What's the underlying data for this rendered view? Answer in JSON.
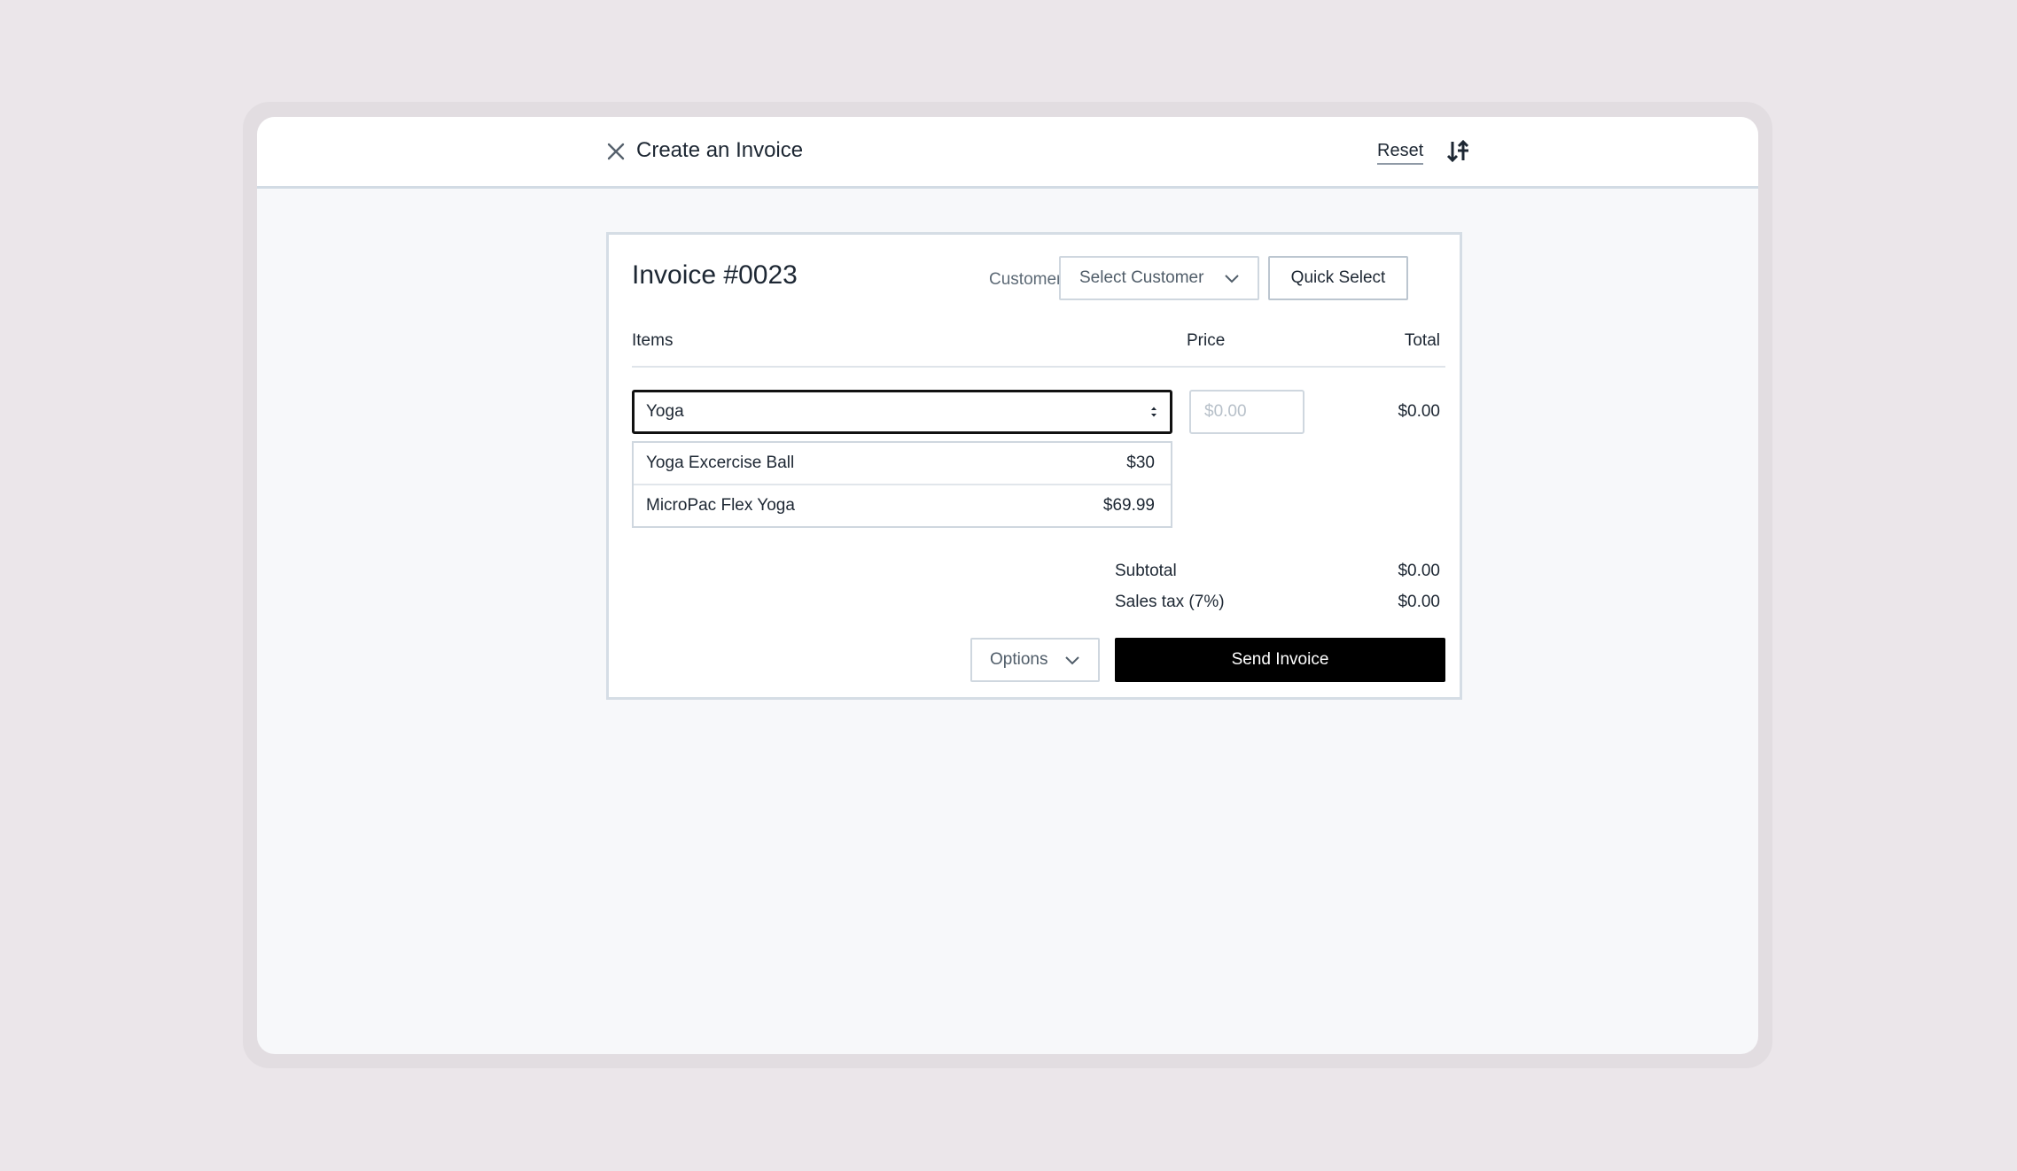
{
  "header": {
    "title": "Create an Invoice",
    "reset_label": "Reset",
    "close_icon": "close-icon",
    "sort_icon": "sort-icon"
  },
  "invoice": {
    "title": "Invoice #0023",
    "customer_label": "Customer:",
    "select_customer_label": "Select Customer",
    "quick_select_label": "Quick Select"
  },
  "table": {
    "columns": [
      "Items",
      "Price",
      "Total"
    ],
    "row": {
      "item_query": "Yoga",
      "price_placeholder": "$0.00",
      "total": "$0.00"
    },
    "suggestions": [
      {
        "name": "Yoga Excercise Ball",
        "price": "$30"
      },
      {
        "name": "MicroPac Flex Yoga",
        "price": "$69.99"
      }
    ]
  },
  "summary": {
    "subtotal_label": "Subtotal",
    "subtotal_value": "$0.00",
    "tax_label": "Sales tax (7%)",
    "tax_value": "$0.00"
  },
  "actions": {
    "options_label": "Options",
    "send_label": "Send Invoice"
  },
  "colors": {
    "background": "#ebe6ea",
    "primary_button": "#000000",
    "border": "#cfd7df"
  }
}
